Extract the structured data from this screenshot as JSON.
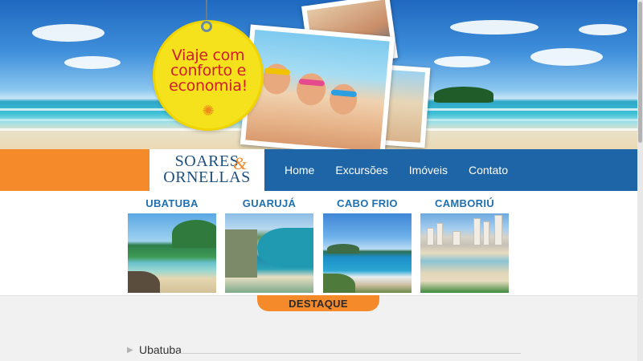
{
  "hero": {
    "badge_line1": "Viaje com",
    "badge_line2": "conforto e",
    "badge_line3": "economia!",
    "sun_icon": "sun-icon"
  },
  "logo": {
    "line1": "SOARES",
    "ampersand": "&",
    "line2": "ORNELLAS"
  },
  "nav": {
    "items": [
      "Home",
      "Excursões",
      "Imóveis",
      "Contato"
    ]
  },
  "destinations": [
    {
      "title": "UBATUBA"
    },
    {
      "title": "GUARUJÁ"
    },
    {
      "title": "CABO FRIO"
    },
    {
      "title": "CAMBORIÚ"
    }
  ],
  "destaque": {
    "label": "DESTAQUE"
  },
  "list": {
    "items": [
      {
        "label": "Ubatuba"
      }
    ]
  },
  "colors": {
    "brand_blue": "#1d65a6",
    "brand_orange": "#f48a2a",
    "badge_yellow": "#f5e21c",
    "badge_text_red": "#d11c2b"
  }
}
